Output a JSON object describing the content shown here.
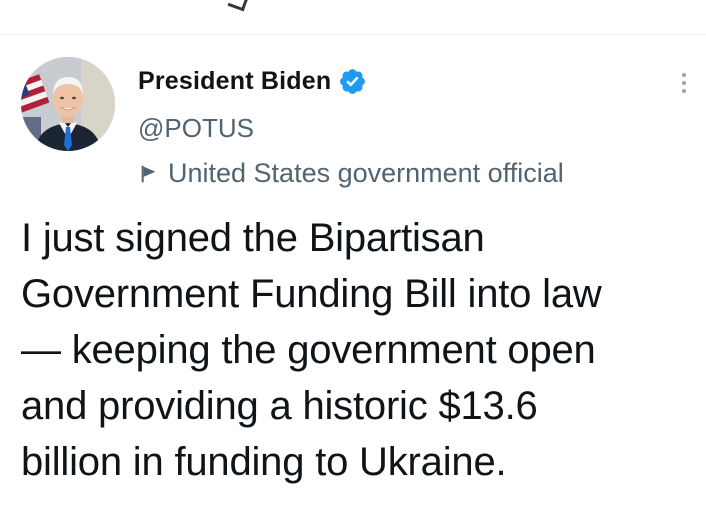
{
  "tweet": {
    "author": {
      "display_name": "President Biden",
      "handle": "@POTUS",
      "verified": true,
      "verified_color": "#1d9bf0",
      "account_label": "United States government official",
      "avatar_icon": "president-portrait"
    },
    "text": "I just signed the Bipartisan\nGovernment Funding Bill into law\n— keeping the government open\nand providing a historic $13.6\nbillion in funding to Ukraine.",
    "more_icon": "kebab-vertical-icon"
  },
  "colors": {
    "text_primary": "#0f1419",
    "text_secondary": "#536471",
    "divider": "#eff3f4",
    "background": "#ffffff"
  }
}
